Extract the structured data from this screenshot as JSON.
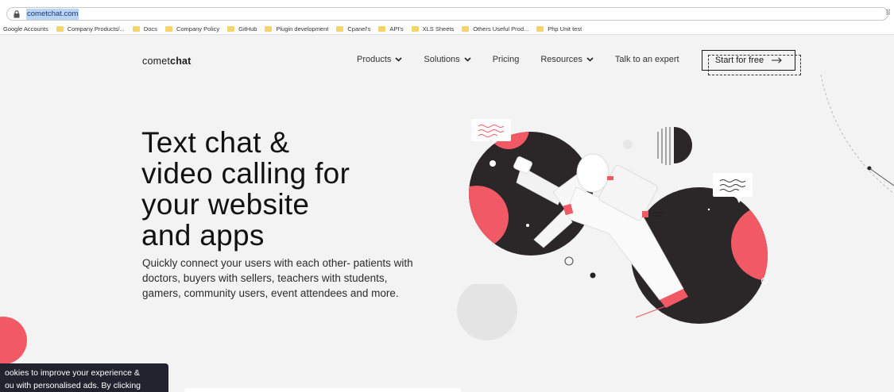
{
  "browser": {
    "url": "cometchat.com",
    "bookmarks": [
      "Google Accounts",
      "Company Products/...",
      "Docs",
      "Company Policy",
      "GitHub",
      "Plugin development",
      "Cpanel's",
      "API's",
      "XLS Sheets",
      "Others Useful Prod...",
      "Php Unit test"
    ]
  },
  "header": {
    "logo_light": "comet",
    "logo_bold": "chat",
    "nav": [
      {
        "label": "Products",
        "dropdown": true
      },
      {
        "label": "Solutions",
        "dropdown": true
      },
      {
        "label": "Pricing",
        "dropdown": false
      },
      {
        "label": "Resources",
        "dropdown": true
      },
      {
        "label": "Talk to an expert",
        "dropdown": false
      }
    ],
    "cta_label": "Start for free"
  },
  "hero": {
    "headline_lines": [
      "Text chat &",
      "video calling for",
      "your website",
      "and apps"
    ],
    "subtext": "Quickly connect your users with each other- patients with doctors, buyers with sellers, teachers with students, gamers, community users, event attendees and more."
  },
  "cookie_banner": {
    "line1": "ookies to improve your experience &",
    "line2": "ou with personalised ads. By clicking"
  },
  "colors": {
    "accent": "#f15a65",
    "dark": "#2b2628",
    "background": "#f3f3f3"
  }
}
